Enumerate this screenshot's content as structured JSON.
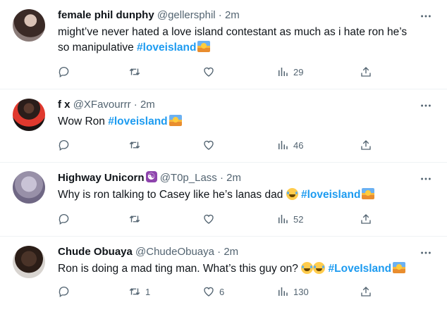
{
  "tweets": [
    {
      "name": "female phil dunphy",
      "handle": "@gellersphil",
      "dot": "·",
      "time": "2m",
      "text": "might’ve never hated a love island contestant as much as i hate ron he’s",
      "text2": "so manipulative",
      "hashtag": "#loveisland",
      "views": "29",
      "retweets": "",
      "likes": ""
    },
    {
      "name": "f x",
      "handle": "@XFavourrr",
      "dot": "·",
      "time": "2m",
      "text": "Wow Ron",
      "hashtag": "#loveisland",
      "views": "46",
      "retweets": "",
      "likes": ""
    },
    {
      "name": "Highway Unicorn",
      "handle": "@T0p_Lass",
      "dot": "·",
      "time": "2m",
      "text": "Why is ron talking to Casey like he’s lanas dad",
      "hashtag": "#loveisland",
      "views": "52",
      "retweets": "",
      "likes": ""
    },
    {
      "name": "Chude Obuaya",
      "handle": "@ChudeObuaya",
      "dot": "·",
      "time": "2m",
      "text": "Ron is doing a mad ting man. What’s this guy on?",
      "hashtag": "#LoveIsland",
      "views": "130",
      "retweets": "1",
      "likes": "6"
    }
  ],
  "icons": {
    "reply": "reply-icon",
    "retweet": "retweet-icon",
    "like": "heart-icon",
    "views": "views-icon",
    "share": "share-icon",
    "more": "more-icon",
    "name_badge": "yin-yang-icon"
  },
  "colors": {
    "hashtag": "#1d9bf0",
    "secondary": "#536471"
  }
}
